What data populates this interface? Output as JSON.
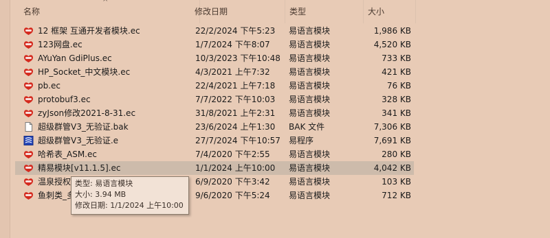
{
  "header": {
    "name": "名称",
    "date": "修改日期",
    "type": "类型",
    "size": "大小",
    "sort_arrow": "^"
  },
  "files": [
    {
      "name": "12 框架 互通开发者模块.ec",
      "date": "22/2/2024 下午5:23",
      "type": "易语言模块",
      "size": "1,986 KB",
      "icon": "ec-module-icon"
    },
    {
      "name": "123网盘.ec",
      "date": "1/7/2024 下午8:07",
      "type": "易语言模块",
      "size": "4,520 KB",
      "icon": "ec-module-icon"
    },
    {
      "name": "AYuYan GdiPlus.ec",
      "date": "10/3/2023 下午10:48",
      "type": "易语言模块",
      "size": "733 KB",
      "icon": "ec-module-icon"
    },
    {
      "name": "HP_Socket_中文模块.ec",
      "date": "4/3/2021 上午7:32",
      "type": "易语言模块",
      "size": "421 KB",
      "icon": "ec-module-icon"
    },
    {
      "name": "pb.ec",
      "date": "22/4/2021 上午7:18",
      "type": "易语言模块",
      "size": "76 KB",
      "icon": "ec-module-icon"
    },
    {
      "name": "protobuf3.ec",
      "date": "7/7/2022 下午10:03",
      "type": "易语言模块",
      "size": "328 KB",
      "icon": "ec-module-icon"
    },
    {
      "name": "zyJson修改2021-8-31.ec",
      "date": "31/8/2021 上午2:31",
      "type": "易语言模块",
      "size": "341 KB",
      "icon": "ec-module-icon"
    },
    {
      "name": "超级群管V3_无验证.bak",
      "date": "23/6/2024 上午1:30",
      "type": "BAK 文件",
      "size": "7,306 KB",
      "icon": "blank-file-icon"
    },
    {
      "name": "超级群管V3_无验证.e",
      "date": "27/7/2024 下午10:57",
      "type": "易程序",
      "size": "7,691 KB",
      "icon": "e-program-icon"
    },
    {
      "name": "哈希表_ASM.ec",
      "date": "7/4/2020 下午2:55",
      "type": "易语言模块",
      "size": "280 KB",
      "icon": "ec-module-icon"
    },
    {
      "name": "精易模块[v11.1.5].ec",
      "date": "1/1/2024 上午10:00",
      "type": "易语言模块",
      "size": "4,042 KB",
      "icon": "ec-module-icon",
      "selected": true
    },
    {
      "name": "温泉授权系统",
      "date": "6/9/2020 下午3:42",
      "type": "易语言模块",
      "size": "103 KB",
      "icon": "ec-module-icon"
    },
    {
      "name": "鱼刺类_多",
      "date": "9/6/2020 下午5:24",
      "type": "易语言模块",
      "size": "712 KB",
      "icon": "ec-module-icon"
    }
  ],
  "tooltip": {
    "type_line": "类型: 易语言模块",
    "size_line": "大小: 3.94 MB",
    "date_line": "修改日期: 1/1/2024 上午10:00"
  }
}
